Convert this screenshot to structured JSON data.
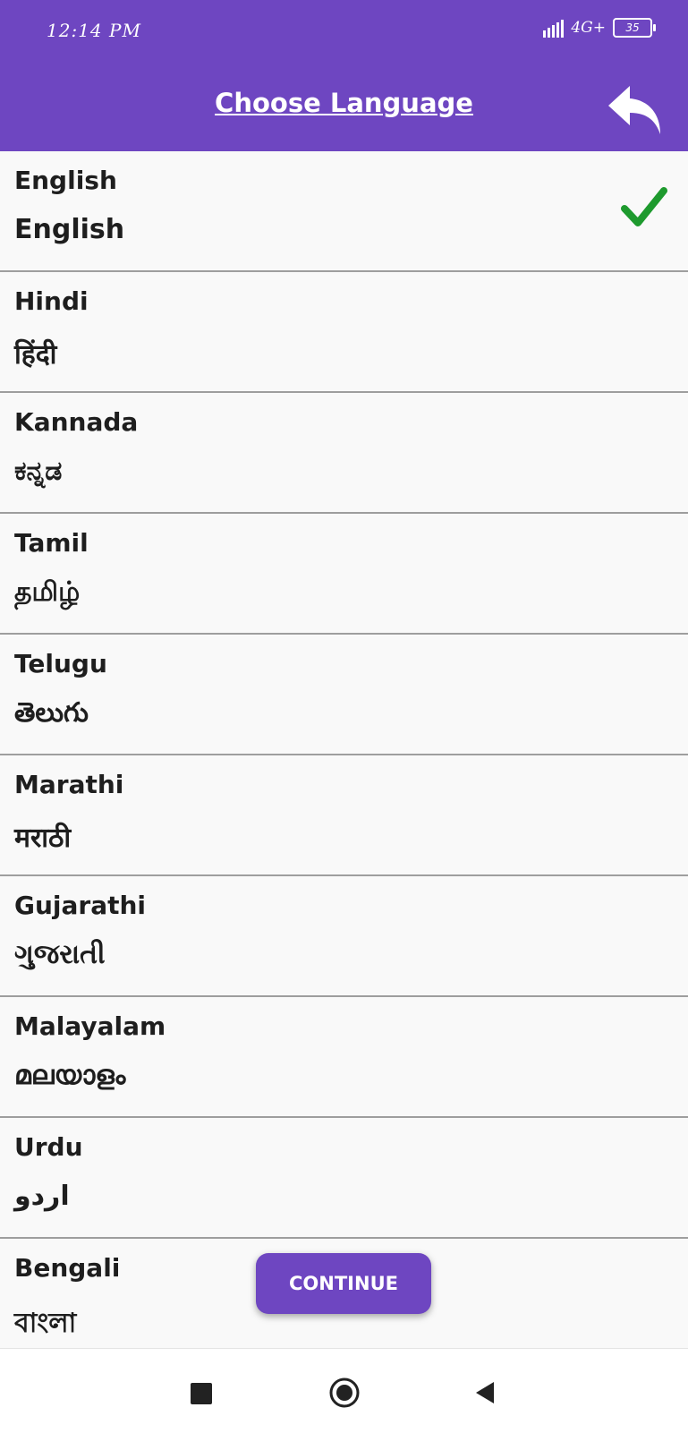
{
  "status_bar": {
    "time": "12:14 PM",
    "network": "4G+",
    "battery": "35"
  },
  "header": {
    "title": "Choose Language",
    "back_icon": "back-arrow-icon"
  },
  "languages": [
    {
      "name": "English",
      "native": "English",
      "selected": true
    },
    {
      "name": "Hindi",
      "native": "हिंदी",
      "selected": false
    },
    {
      "name": "Kannada",
      "native": "ಕನ್ನಡ",
      "selected": false
    },
    {
      "name": "Tamil",
      "native": "தமிழ்",
      "selected": false
    },
    {
      "name": "Telugu",
      "native": "తెలుగు",
      "selected": false
    },
    {
      "name": "Marathi",
      "native": "मराठी",
      "selected": false
    },
    {
      "name": "Gujarathi",
      "native": "ગુજરાતી",
      "selected": false
    },
    {
      "name": "Malayalam",
      "native": "മലയാളം",
      "selected": false
    },
    {
      "name": "Urdu",
      "native": "اردو",
      "selected": false
    },
    {
      "name": "Bengali",
      "native": "বাংলা",
      "selected": false
    }
  ],
  "continue_label": "CONTINUE",
  "colors": {
    "accent": "#6e46c1",
    "check": "#1e9a2e"
  },
  "navigation": {
    "recents_icon": "square-icon",
    "home_icon": "circle-home-icon",
    "back_icon": "triangle-back-icon"
  }
}
